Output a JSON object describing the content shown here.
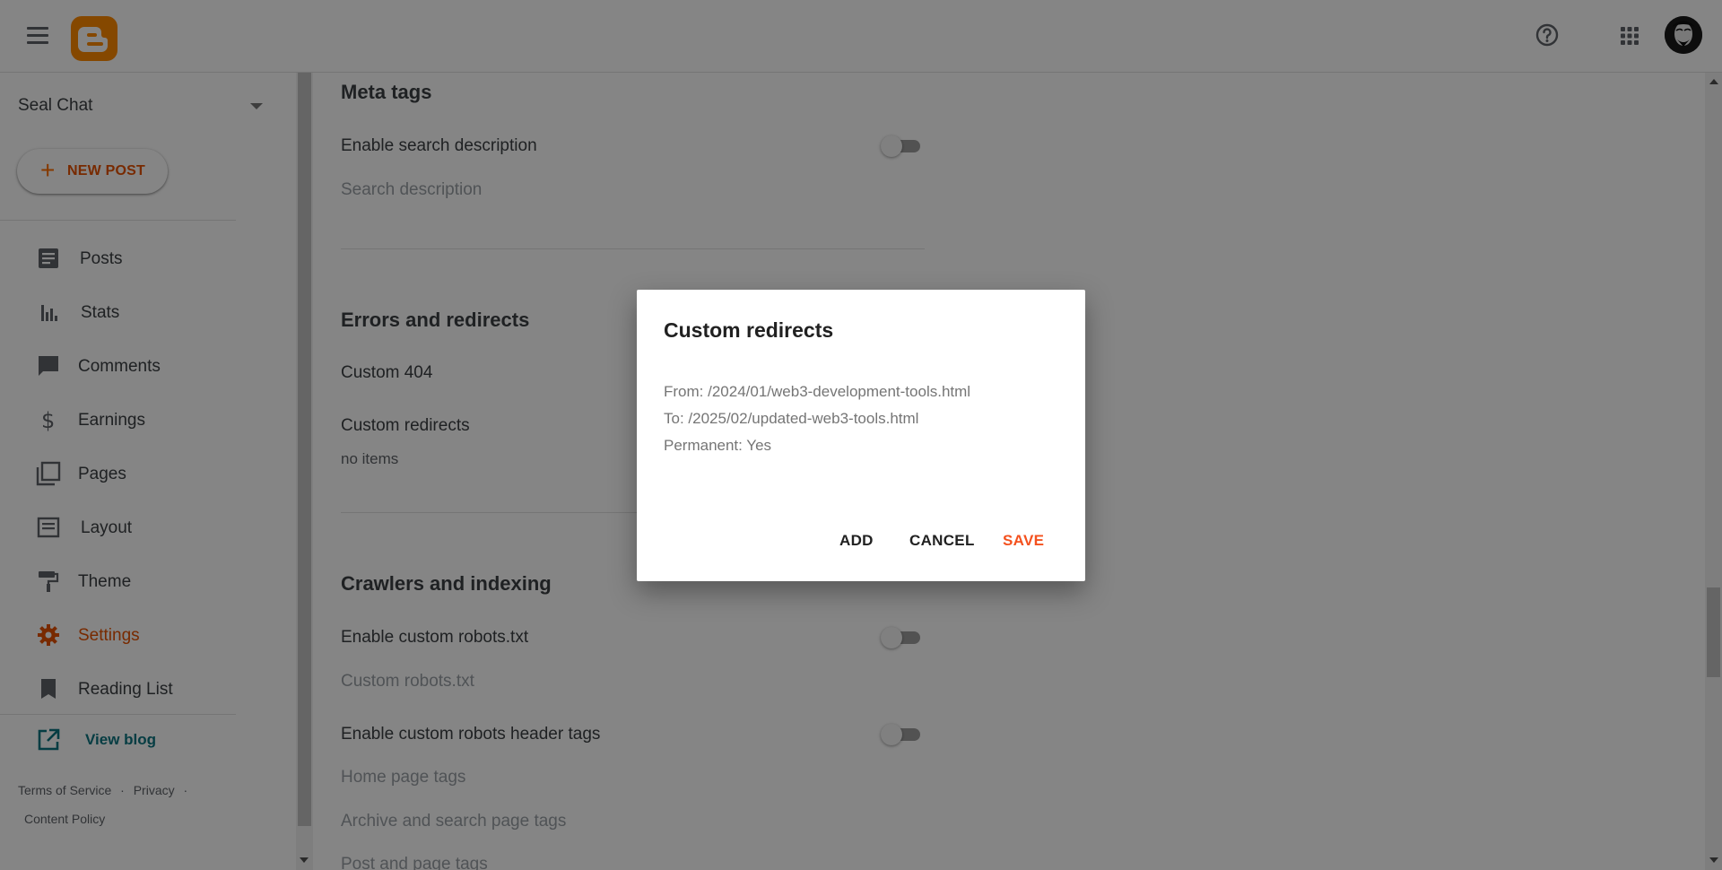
{
  "header": {
    "menu_icon": "hamburger-icon",
    "logo_icon": "blogger-logo",
    "help_icon": "help-circle-icon",
    "apps_icon": "apps-grid-icon",
    "avatar_icon": "user-avatar"
  },
  "sidebar": {
    "blog_name": "Seal Chat",
    "new_post_label": "NEW POST",
    "items": [
      {
        "label": "Posts",
        "icon": "posts-icon"
      },
      {
        "label": "Stats",
        "icon": "stats-icon"
      },
      {
        "label": "Comments",
        "icon": "comments-icon"
      },
      {
        "label": "Earnings",
        "icon": "dollar-icon"
      },
      {
        "label": "Pages",
        "icon": "pages-icon"
      },
      {
        "label": "Layout",
        "icon": "layout-icon"
      },
      {
        "label": "Theme",
        "icon": "paint-roller-icon"
      },
      {
        "label": "Settings",
        "icon": "gear-icon",
        "active": true
      },
      {
        "label": "Reading List",
        "icon": "bookmark-icon"
      }
    ],
    "view_blog_label": "View blog",
    "footer": {
      "terms": "Terms of Service",
      "sep": "·",
      "privacy": "Privacy",
      "content_policy": "Content Policy"
    }
  },
  "main": {
    "meta_tags": {
      "title": "Meta tags",
      "enable_search_description": "Enable search description",
      "search_description": "Search description"
    },
    "errors": {
      "title": "Errors and redirects",
      "custom_404": "Custom 404",
      "custom_redirects": "Custom redirects",
      "custom_redirects_value": "no items"
    },
    "crawlers": {
      "title": "Crawlers and indexing",
      "enable_robots_txt": "Enable custom robots.txt",
      "custom_robots_txt": "Custom robots.txt",
      "enable_robots_header": "Enable custom robots header tags",
      "home_page_tags": "Home page tags",
      "archive_search_tags": "Archive and search page tags",
      "post_page_tags": "Post and page tags"
    }
  },
  "dialog": {
    "title": "Custom redirects",
    "from": "From: /2024/01/web3-development-tools.html",
    "to": "To: /2025/02/updated-web3-tools.html",
    "permanent": "Permanent: Yes",
    "add_label": "ADD",
    "cancel_label": "CANCEL",
    "save_label": "SAVE"
  },
  "colors": {
    "accent": "#e65100",
    "link": "#0d7580",
    "save": "#f4511e"
  }
}
